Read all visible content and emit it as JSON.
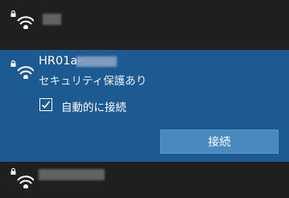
{
  "networks": [
    {
      "ssid": "",
      "secured": true,
      "state": "collapsed"
    },
    {
      "ssid": "HR01a-",
      "secured": true,
      "state": "expanded",
      "security_text": "セキュリティ保護あり",
      "auto_connect": {
        "label": "自動的に接続",
        "checked": true
      },
      "connect_label": "接続"
    },
    {
      "ssid": "",
      "secured": true,
      "state": "collapsed"
    }
  ],
  "colors": {
    "background": "#1f1f1f",
    "selected": "#1d5a92",
    "button": "#4a88c0"
  },
  "icons": [
    "wifi-secured-icon",
    "lock-icon",
    "checkmark-icon"
  ]
}
